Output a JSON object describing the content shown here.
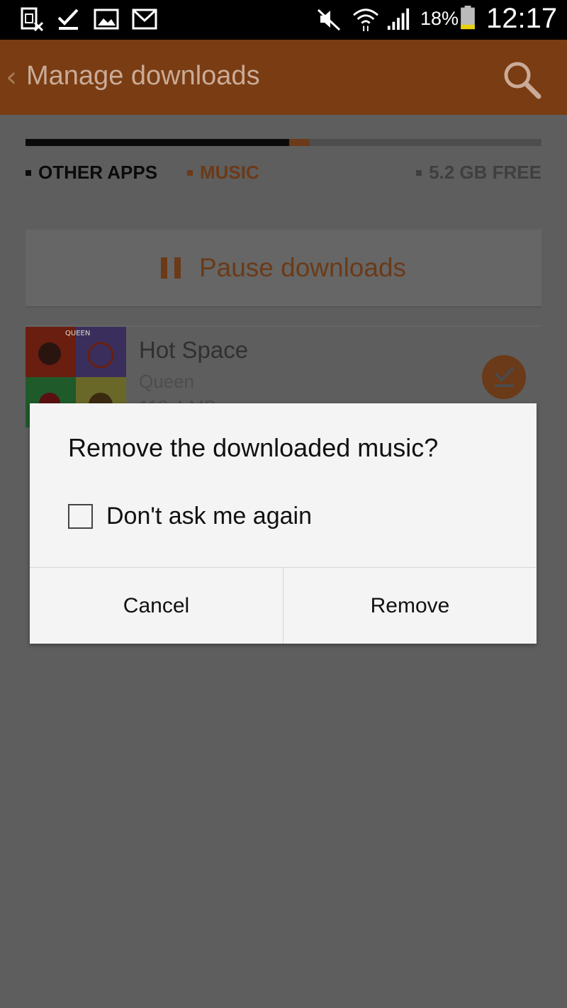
{
  "status_bar": {
    "battery_percent": "18%",
    "time": "12:17",
    "icons": [
      "sim-card-icon",
      "checkmark-icon",
      "image-icon",
      "gmail-icon",
      "mute-icon",
      "wifi-icon",
      "signal-icon",
      "battery-icon"
    ]
  },
  "app_bar": {
    "title": "Manage downloads",
    "back_icon": "chevron-left-icon",
    "search_icon": "search-icon"
  },
  "storage": {
    "other_apps_fraction": 0.511,
    "music_fraction": 0.04,
    "legend_other": "OTHER APPS",
    "legend_music": "MUSIC",
    "legend_free": "5.2 GB FREE"
  },
  "pause_button": {
    "label": "Pause downloads",
    "icon": "pause-icon"
  },
  "album": {
    "title": "Hot Space",
    "artist": "Queen",
    "size": "113.4 MB",
    "art_text_band": "QUEEN",
    "art_text_album": "Hot Space",
    "status_icon": "downloaded-check-icon"
  },
  "dialog": {
    "title": "Remove the downloaded music?",
    "checkbox_label": "Don't ask me again",
    "checkbox_checked": false,
    "cancel_label": "Cancel",
    "remove_label": "Remove"
  },
  "colors": {
    "accent": "#e87d2a",
    "app_bar": "#7a3c12",
    "scrim": "#5e5e5e",
    "dialog_bg": "#f4f4f4"
  }
}
